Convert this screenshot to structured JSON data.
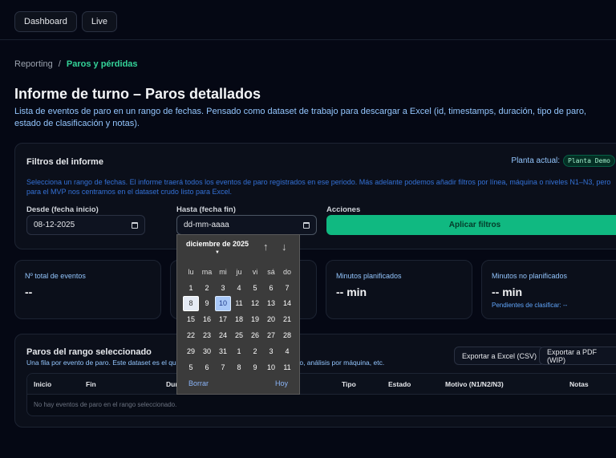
{
  "topbar": {
    "tabs": [
      "Dashboard",
      "Live"
    ]
  },
  "breadcrumb": {
    "parent": "Reporting",
    "sep": "/",
    "current": "Paros y pérdidas"
  },
  "page": {
    "title": "Informe de turno – Paros detallados",
    "description": "Lista de eventos de paro en un rango de fechas. Pensado como dataset de trabajo para descargar a Excel (id, timestamps, duración, tipo de paro, estado de clasificación y notas)."
  },
  "filters": {
    "title": "Filtros del informe",
    "plant_label": "Planta actual:",
    "plant_value": "Planta Demo",
    "help": "Selecciona un rango de fechas. El informe traerá todos los eventos de paro registrados en ese periodo. Más adelante podemos añadir filtros por línea, máquina o niveles N1–N3, pero para el MVP nos centramos en el dataset crudo listo para Excel.",
    "from_label": "Desde (fecha inicio)",
    "from_value": "08-12-2025",
    "to_label": "Hasta (fecha fin)",
    "to_placeholder": "dd-mm-aaaa",
    "actions_label": "Acciones",
    "apply": "Aplicar filtros"
  },
  "stats": [
    {
      "title": "Nº total de eventos",
      "value": "--"
    },
    {
      "title": "",
      "value": ""
    },
    {
      "title": "Minutos planificados",
      "value": "-- min"
    },
    {
      "title": "Minutos no planificados",
      "value": "-- min",
      "sub": "Pendientes de clasificar: --"
    }
  ],
  "table": {
    "title": "Paros del rango seleccionado",
    "subtitle": "Una fila por evento de paro. Este dataset es el que ... to, análisis por máquina, etc.",
    "sub_left": "Una fila por evento de paro. Este dataset es el que",
    "sub_right": "to, análisis por máquina, etc.",
    "export_csv": "Exportar a Excel (CSV)",
    "export_pdf": "Exportar a PDF (WIP)",
    "columns": [
      "Inicio",
      "Fin",
      "Dur",
      "Tipo",
      "Estado",
      "Motivo (N1/N2/N3)",
      "Notas"
    ],
    "empty": "No hay eventos de paro en el rango seleccionado."
  },
  "datepicker": {
    "month": "diciembre de 2025",
    "weekdays": [
      "lu",
      "ma",
      "mi",
      "ju",
      "vi",
      "sá",
      "do"
    ],
    "days": [
      "1",
      "2",
      "3",
      "4",
      "5",
      "6",
      "7",
      "8",
      "9",
      "10",
      "11",
      "12",
      "13",
      "14",
      "15",
      "16",
      "17",
      "18",
      "19",
      "20",
      "21",
      "22",
      "23",
      "24",
      "25",
      "26",
      "27",
      "28",
      "29",
      "30",
      "31",
      "1",
      "2",
      "3",
      "4",
      "5",
      "6",
      "7",
      "8",
      "9",
      "10",
      "11"
    ],
    "today": "10",
    "hovered": "8",
    "clear": "Borrar",
    "today_label": "Hoy"
  }
}
